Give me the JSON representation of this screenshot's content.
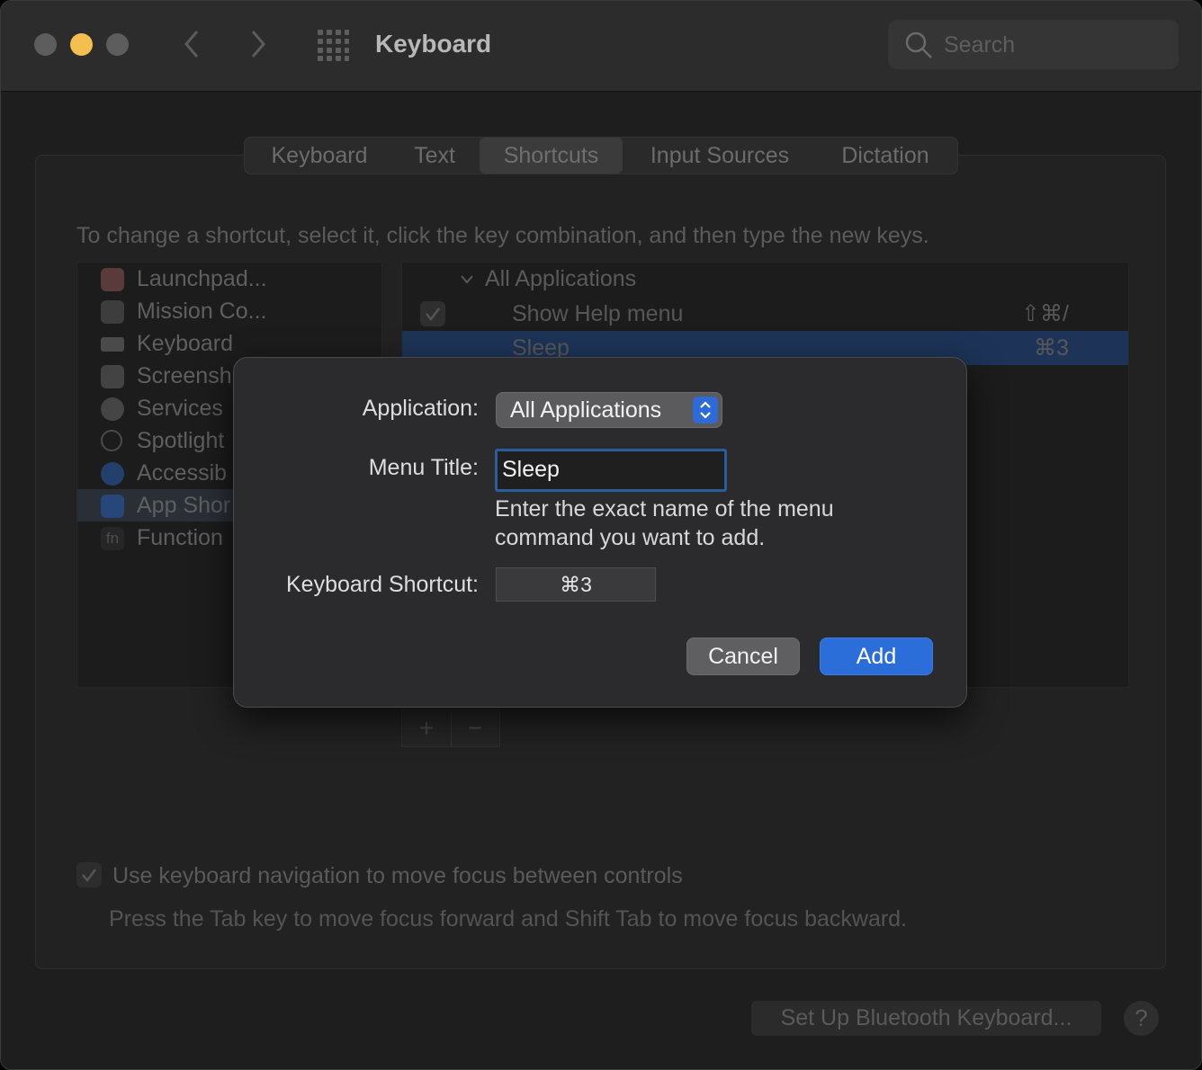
{
  "window": {
    "title": "Keyboard"
  },
  "search": {
    "placeholder": "Search"
  },
  "tabs": [
    "Keyboard",
    "Text",
    "Shortcuts",
    "Input Sources",
    "Dictation"
  ],
  "instruction": "To change a shortcut, select it, click the key combination, and then type the new keys.",
  "categories": [
    {
      "label": "Launchpad...",
      "icon": "launchpad-icon"
    },
    {
      "label": "Mission Co...",
      "icon": "mission-control-icon"
    },
    {
      "label": "Keyboard",
      "icon": "keyboard-icon"
    },
    {
      "label": "Screensh",
      "icon": "screenshot-icon"
    },
    {
      "label": "Services",
      "icon": "gear-icon"
    },
    {
      "label": "Spotlight",
      "icon": "magnifier-icon"
    },
    {
      "label": "Accessib",
      "icon": "accessibility-icon"
    },
    {
      "label": "App Shor",
      "icon": "app-store-icon"
    },
    {
      "label": "Function",
      "icon": "fn-icon"
    }
  ],
  "shortcuts": {
    "group": "All Applications",
    "rows": [
      {
        "name": "Show Help menu",
        "keys": "⇧⌘/",
        "checked": true
      },
      {
        "name": "Sleep",
        "keys": "⌘3",
        "selected": true
      }
    ]
  },
  "list_buttons": {
    "add": "+",
    "remove": "−"
  },
  "keyboard_nav": {
    "label": "Use keyboard navigation to move focus between controls",
    "hint": "Press the Tab key to move focus forward and Shift Tab to move focus backward."
  },
  "bluetooth_button": "Set Up Bluetooth Keyboard...",
  "help_button": "?",
  "sheet": {
    "application_label": "Application:",
    "application_value": "All Applications",
    "menu_title_label": "Menu Title:",
    "menu_title_value": "Sleep",
    "hint_line1": "Enter the exact name of the menu",
    "hint_line2": "command you want to add.",
    "shortcut_label": "Keyboard Shortcut:",
    "shortcut_value": "⌘3",
    "cancel_label": "Cancel",
    "add_label": "Add"
  },
  "colors": {
    "accent": "#2c6ed9",
    "selection_row": "#1d3458",
    "traffic_yellow": "#f5bf4f"
  }
}
